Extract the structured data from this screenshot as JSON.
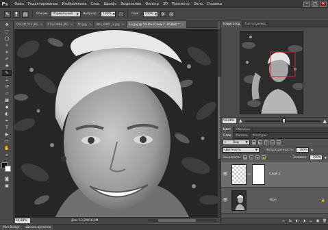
{
  "app": {
    "logo": "Ps"
  },
  "menu": [
    "Файл",
    "Редактирование",
    "Изображение",
    "Слои",
    "Шрифт",
    "Выделение",
    "Фильтр",
    "3D",
    "Просмотр",
    "Окно",
    "Справка"
  ],
  "window_controls": {
    "minimize": "–",
    "restore": "□",
    "close": "✕"
  },
  "options": {
    "brush_size": "8",
    "mode_label": "Режим:",
    "mode_value": "Нормальный",
    "opacity_label": "Непрозр.:",
    "opacity_value": "100%",
    "pressure_label": "Наж.:",
    "pressure_value": "100%"
  },
  "tabs": [
    {
      "label": "DSCN1553.JPG",
      "close": "×"
    },
    {
      "label": "P7123886.JPG",
      "close": "×"
    },
    {
      "label": "16.jpg",
      "close": "×"
    },
    {
      "label": "IMG_6881_1.jpg",
      "close": "×"
    },
    {
      "label": "13.jpg @ 54,9% (Слой 1, RGB/8) *",
      "close": "×",
      "active": true
    }
  ],
  "status": {
    "zoom": "54,88%",
    "doc": "Док: 13,2M/16,0M"
  },
  "bottom_tabs": [
    "Mini Bridge",
    "Шкала времени"
  ],
  "navigator": {
    "tabs": [
      "Навигатор",
      "Гистограмма"
    ],
    "zoom": "54,88%",
    "zoom_fraction": 0.52
  },
  "layers_panel": {
    "top_tabs": [
      "Цвет",
      "Образцы"
    ],
    "tabs": [
      "Слои",
      "Каналы",
      "Контуры"
    ],
    "filter_kind": "Вид",
    "blend_mode": "Цветность",
    "opacity_label": "Непрозрачность:",
    "opacity_value": "100%",
    "lock_label": "Закрепить:",
    "fill_label": "Заливка:",
    "fill_value": "100%",
    "layers": [
      {
        "name": "Слой 1",
        "selected": true
      },
      {
        "name": "Фон",
        "locked": true
      }
    ]
  },
  "icons": {
    "eye": "👁",
    "lock": "🔒",
    "chain": "∞",
    "footer": [
      "∞",
      "fx",
      "◐",
      "◑",
      "▭",
      "▣",
      "🗑"
    ]
  }
}
